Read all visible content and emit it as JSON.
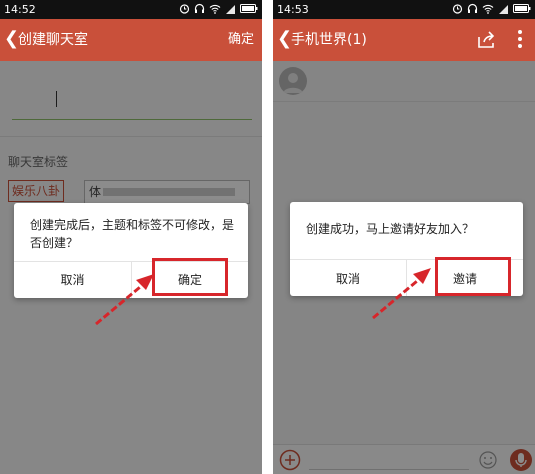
{
  "left": {
    "status_time": "14:52",
    "title": "创建聊天室",
    "confirm_label": "确定",
    "tag_section_label": "聊天室标签",
    "tag_selected": "娱乐八卦",
    "tag_input_value": "体",
    "dialog": {
      "message": "创建完成后，主题和标签不可修改，是否创建？",
      "cancel_label": "取消",
      "ok_label": "确定"
    }
  },
  "right": {
    "status_time": "14:53",
    "title": "手机世界(1)",
    "dialog": {
      "message": "创建成功，马上邀请好友加入？",
      "cancel_label": "取消",
      "ok_label": "邀请"
    }
  },
  "colors": {
    "titlebar": "#c9503a",
    "highlight": "#d7262b",
    "statusbar": "#111111"
  },
  "icons": [
    "back-arrow-icon",
    "alarm-icon",
    "headset-icon",
    "wifi-icon",
    "signal-icon",
    "battery-icon",
    "share-icon",
    "more-icon",
    "plus-icon",
    "emoji-icon",
    "mic-icon",
    "avatar-icon"
  ]
}
